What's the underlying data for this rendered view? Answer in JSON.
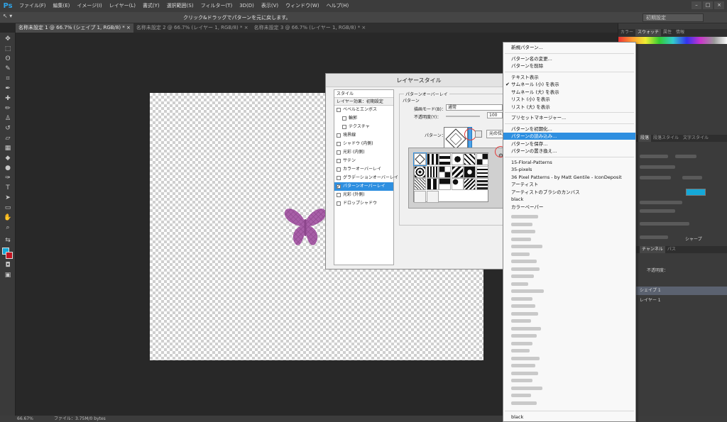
{
  "app": {
    "logo": "Ps",
    "menu": [
      "ファイル(F)",
      "編集(E)",
      "イメージ(I)",
      "レイヤー(L)",
      "書式(Y)",
      "選択範囲(S)",
      "フィルター(T)",
      "3D(D)",
      "表示(V)",
      "ウィンドウ(W)",
      "ヘルプ(H)"
    ],
    "window_controls": [
      "–",
      "□",
      "×"
    ]
  },
  "options_bar": {
    "tool_preset": "↖ ▾",
    "hint": "クリック&ドラッグでパターンを元に戻します。",
    "workspace": "初期設定"
  },
  "doc_tabs": [
    {
      "label": "名称未設定 1 @ 66.7% (シェイプ 1, RGB/8) * ×",
      "active": true
    },
    {
      "label": "名称未設定 2 @ 66.7% (レイヤー 1, RGB/8) * ×",
      "active": false
    },
    {
      "label": "名称未設定 3 @ 66.7% (レイヤー 1, RGB/8) * ×",
      "active": false
    }
  ],
  "status": {
    "zoom": "66.67%",
    "file": "ファイル：3.75M/0 bytes"
  },
  "right_panel": {
    "top_tabs": [
      "カラー",
      "スウォッチ",
      "属性",
      "情報"
    ],
    "char_tabs": [
      "段落",
      "段落スタイル",
      "文字スタイル"
    ],
    "layer_tabs": [
      "チャンネル",
      "パス"
    ],
    "opacity_label": "不透明度：",
    "layers": [
      {
        "name": "シェイプ 1",
        "selected": true
      },
      {
        "name": "レイヤー 1",
        "selected": false
      }
    ],
    "sharp": "シャープ",
    "colors": {
      "cyan": "#14a8d8"
    }
  },
  "dialog": {
    "title": "レイヤースタイル",
    "style_header": "スタイル",
    "defaults": "レイヤー効果：初期設定",
    "styles": [
      {
        "label": "ベベルとエンボス",
        "checked": false,
        "sub": false,
        "selected": false
      },
      {
        "label": "輪郭",
        "checked": false,
        "sub": true,
        "selected": false
      },
      {
        "label": "テクスチャ",
        "checked": false,
        "sub": true,
        "selected": false
      },
      {
        "label": "境界線",
        "checked": false,
        "sub": false,
        "selected": false
      },
      {
        "label": "シャドウ (内側)",
        "checked": false,
        "sub": false,
        "selected": false
      },
      {
        "label": "光彩 (内側)",
        "checked": false,
        "sub": false,
        "selected": false
      },
      {
        "label": "サテン",
        "checked": false,
        "sub": false,
        "selected": false
      },
      {
        "label": "カラーオーバーレイ",
        "checked": false,
        "sub": false,
        "selected": false
      },
      {
        "label": "グラデーションオーバーレイ",
        "checked": false,
        "sub": false,
        "selected": false
      },
      {
        "label": "パターンオーバーレイ",
        "checked": true,
        "sub": false,
        "selected": true
      },
      {
        "label": "光彩 (外側)",
        "checked": false,
        "sub": false,
        "selected": false
      },
      {
        "label": "ドロップシャドウ",
        "checked": false,
        "sub": false,
        "selected": false
      }
    ],
    "group_title": "パターンオーバーレイ",
    "sub_title": "パターン",
    "blend_label": "描画モード(B)：",
    "blend_value": "通常",
    "opacity_label": "不透明度(Y)：",
    "opacity_value": "100",
    "pattern_label": "パターン：",
    "snap_origin": "元の位置に"
  },
  "context_menu": {
    "groups": [
      [
        {
          "label": "新規パターン..."
        }
      ],
      [
        {
          "label": "パターン名の変更..."
        },
        {
          "label": "パターンを削除"
        }
      ],
      [
        {
          "label": "テキスト表示"
        },
        {
          "label": "サムネール (小) を表示",
          "checked": true
        },
        {
          "label": "サムネール (大) を表示"
        },
        {
          "label": "リスト (小) を表示"
        },
        {
          "label": "リスト (大) を表示"
        }
      ],
      [
        {
          "label": "プリセットマネージャー..."
        }
      ],
      [
        {
          "label": "パターンを初期化..."
        },
        {
          "label": "パターンの読み込み...",
          "highlighted": true
        },
        {
          "label": "パターンを保存..."
        },
        {
          "label": "パターンの置き換え..."
        }
      ],
      [
        {
          "label": "15-Floral-Patterns"
        },
        {
          "label": "35-pixels"
        },
        {
          "label": "36 Pixel Patterns - by Matt Gentile - IconDeposit"
        },
        {
          "label": "アーティスト"
        },
        {
          "label": "アーティストのブラシのカンバス"
        },
        {
          "label": "black"
        },
        {
          "label": "カラーペーパー"
        }
      ]
    ],
    "footer": "black"
  }
}
